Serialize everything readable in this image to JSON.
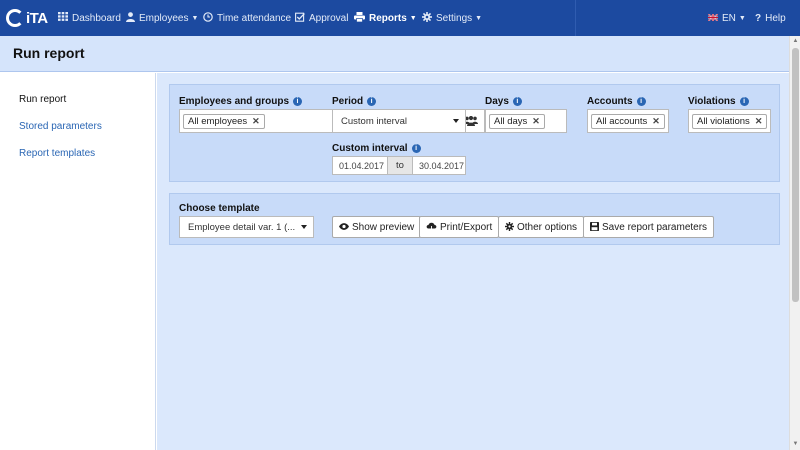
{
  "nav": {
    "logo": "iTA",
    "items": [
      {
        "label": "Dashboard",
        "icon": "grid-icon"
      },
      {
        "label": "Employees",
        "icon": "user-icon"
      },
      {
        "label": "Time attendance",
        "icon": "clock-icon"
      },
      {
        "label": "Approval",
        "icon": "check-square-icon"
      },
      {
        "label": "Reports",
        "icon": "print-icon"
      },
      {
        "label": "Settings",
        "icon": "gear-icon"
      }
    ],
    "language": "EN",
    "help": "Help"
  },
  "page": {
    "title": "Run report"
  },
  "sidebar": {
    "items": [
      {
        "label": "Run report"
      },
      {
        "label": "Stored parameters"
      },
      {
        "label": "Report templates"
      }
    ]
  },
  "filters": {
    "employees": {
      "label": "Employees and groups",
      "tag": "All employees"
    },
    "period": {
      "label": "Period",
      "value": "Custom interval"
    },
    "days": {
      "label": "Days",
      "tag": "All days"
    },
    "accounts": {
      "label": "Accounts",
      "tag": "All accounts"
    },
    "violations": {
      "label": "Violations",
      "tag": "All violations"
    },
    "custom_interval": {
      "label": "Custom interval",
      "from": "01.04.2017",
      "separator": "to",
      "to": "30.04.2017"
    }
  },
  "template": {
    "label": "Choose template",
    "value": "Employee detail var. 1 (...",
    "buttons": {
      "preview": "Show preview",
      "print": "Print/Export",
      "options": "Other options",
      "save": "Save report parameters"
    }
  },
  "colors": {
    "navbar": "#1c4aa0",
    "header": "#d5e4fb",
    "panel": "#c8dbf9",
    "link": "#2a66b4"
  }
}
